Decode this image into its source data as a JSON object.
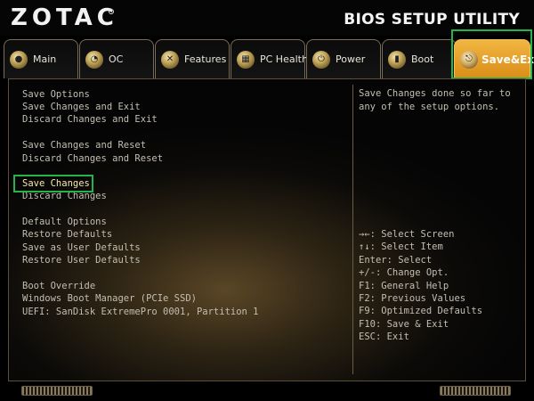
{
  "header": {
    "brand": "ZOTAC",
    "title": "BIOS SETUP UTILITY"
  },
  "tabs": [
    {
      "label": "Main",
      "icon": "main-icon"
    },
    {
      "label": "OC",
      "icon": "oc-icon"
    },
    {
      "label": "Features",
      "icon": "features-icon"
    },
    {
      "label": "PC Health",
      "icon": "pc-health-icon"
    },
    {
      "label": "Power",
      "icon": "power-icon"
    },
    {
      "label": "Boot",
      "icon": "boot-icon"
    },
    {
      "label": "Save&Exit",
      "icon": "save-exit-icon",
      "active": true
    }
  ],
  "menu": {
    "items": [
      "Save Options",
      "Save Changes and Exit",
      "Discard Changes and Exit",
      "Save Changes and Reset",
      "Discard Changes and Reset",
      "Save Changes",
      "Discard Changes",
      "Default Options",
      "Restore Defaults",
      "Save as User Defaults",
      "Restore User Defaults",
      "Boot Override",
      "Windows Boot Manager (PCIe SSD)",
      "UEFI: SanDisk ExtremePro 0001, Partition 1"
    ],
    "selected": "Save Changes"
  },
  "help": {
    "text": "Save Changes done so far to any of the setup options."
  },
  "keys": [
    "→←: Select Screen",
    "↑↓: Select Item",
    "Enter: Select",
    "+/-: Change Opt.",
    "F1: General Help",
    "F2: Previous Values",
    "F9: Optimized Defaults",
    "F10: Save & Exit",
    "ESC: Exit"
  ],
  "colors": {
    "accent": "#e8a12a",
    "highlight_box": "#27b34b",
    "selected_text": "#f5e9a8"
  }
}
